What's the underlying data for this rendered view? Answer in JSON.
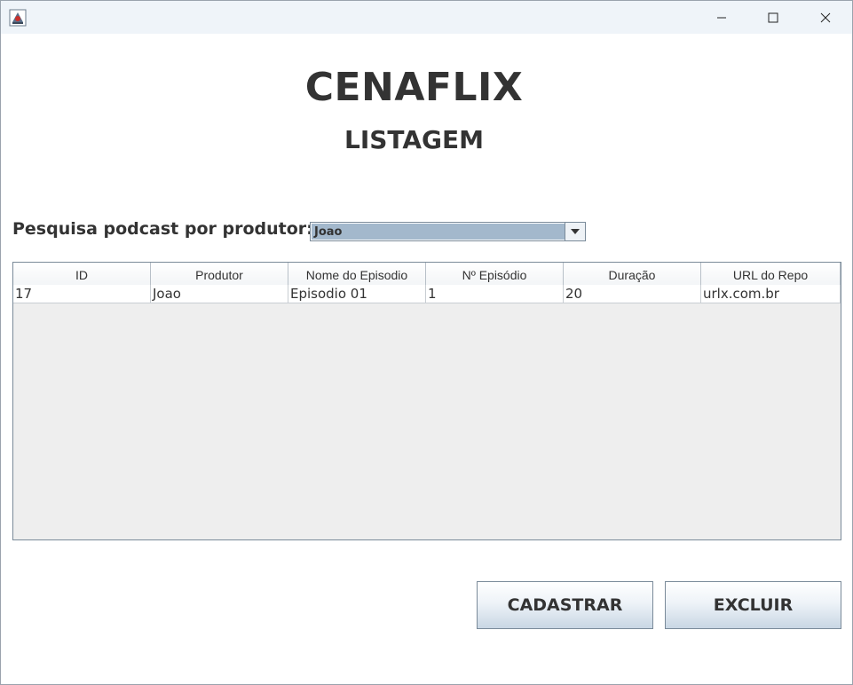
{
  "window": {
    "icons": {
      "app": "java-app-icon",
      "minimize": "minimize-icon",
      "maximize": "maximize-icon",
      "close": "close-icon"
    }
  },
  "header": {
    "title": "CENAFLIX",
    "subtitle": "LISTAGEM"
  },
  "search": {
    "label": "Pesquisa podcast por produtor:",
    "selected": "Joao"
  },
  "table": {
    "columns": [
      "ID",
      "Produtor",
      "Nome do Episodio",
      "Nº Episódio",
      "Duração",
      "URL do Repo"
    ],
    "rows": [
      [
        "17",
        "Joao",
        "Episodio 01",
        "1",
        "20",
        "urlx.com.br"
      ]
    ]
  },
  "buttons": {
    "cadastrar": "CADASTRAR",
    "excluir": "EXCLUIR"
  },
  "colors": {
    "selection": "#a3b8cc",
    "titlebar": "#eff4f9",
    "table_bg": "#eeeeee"
  }
}
